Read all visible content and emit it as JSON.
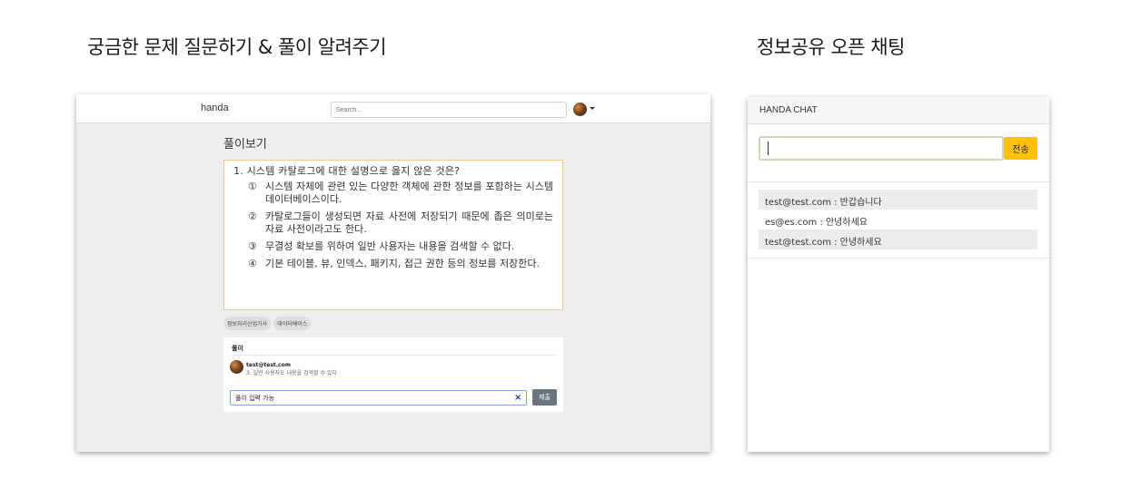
{
  "headings": {
    "left": "궁금한 문제 질문하기 & 풀이 알려주기",
    "right": "정보공유 오픈 채팅"
  },
  "navbar": {
    "brand": "handa",
    "search_placeholder": "Search..."
  },
  "page": {
    "title": "풀이보기"
  },
  "question": {
    "title": "1. 시스템 카탈로그에 대한 설명으로 옳지 않은 것은?",
    "options": [
      {
        "num": "①",
        "text": "시스템 자체에 관련 있는 다양한 객체에 관한 정보를 포함하는 시스템 데이터베이스이다."
      },
      {
        "num": "②",
        "text": "카탈로그들이 생성되면 자료 사전에 저장되기 때문에 좁은 의미로는 자료 사전이라고도 한다."
      },
      {
        "num": "③",
        "text": "무결성 확보를 위하여 일반 사용자는 내용을 검색할 수 없다."
      },
      {
        "num": "④",
        "text": "기본 테이블, 뷰, 인덱스, 패키지, 접근 권한 등의 정보를 저장한다."
      }
    ]
  },
  "tags": [
    "정보처리산업기사",
    "데이터베이스"
  ],
  "answer": {
    "label": "풀이",
    "author": "test@test.com",
    "content": "3. 일반 사용자도 내용을 검색할 수 있다",
    "input_value": "풀이 입력 가능",
    "clear_icon": "×",
    "submit_label": "제출"
  },
  "chat": {
    "title": "HANDA CHAT",
    "send_label": "전송",
    "input_value": "",
    "messages": [
      "test@test.com : 반갑습니다",
      "es@es.com : 안녕하세요",
      "test@test.com : 안녕하세요"
    ]
  },
  "colors": {
    "question_border": "#f5c98c",
    "send_button": "#ffc107",
    "submit_button": "#6c757d",
    "chat_input_border": "#c7dcb2",
    "answer_input_border": "#7aa6e8"
  }
}
